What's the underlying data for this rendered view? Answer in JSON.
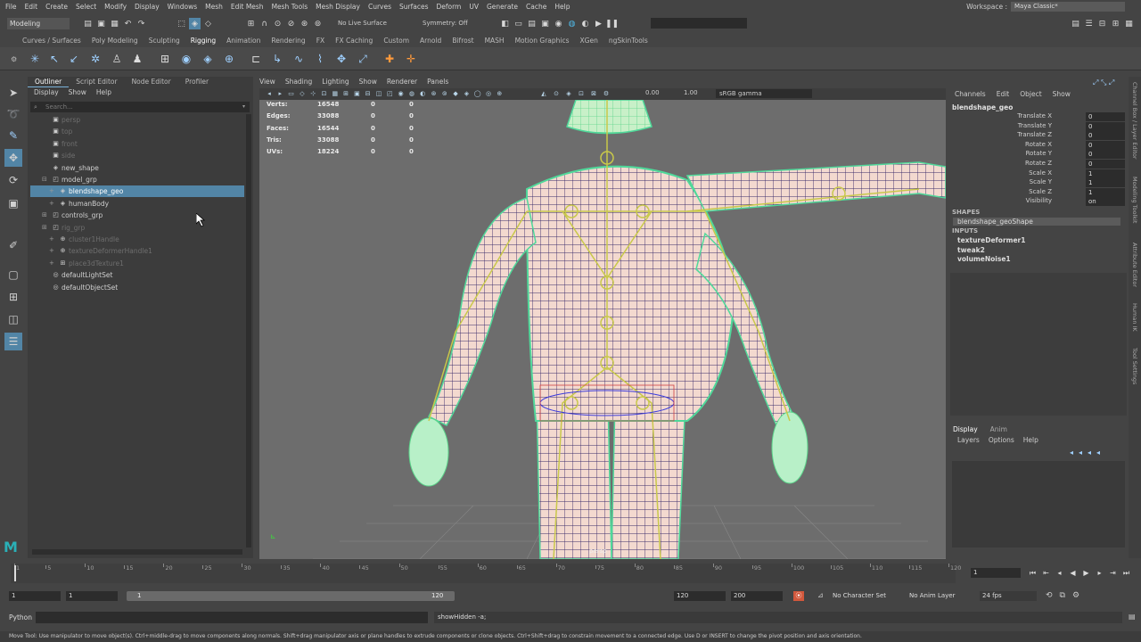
{
  "menubar": {
    "items": [
      "File",
      "Edit",
      "Create",
      "Select",
      "Modify",
      "Display",
      "Windows",
      "Mesh",
      "Edit Mesh",
      "Mesh Tools",
      "Mesh Display",
      "Curves",
      "Surfaces",
      "Deform",
      "UV",
      "Generate",
      "Cache",
      "Help"
    ],
    "workspace_label": "Workspace :",
    "workspace_value": "Maya Classic*"
  },
  "statusline": {
    "mode": "Modeling",
    "live_surface": "No Live Surface",
    "symmetry": "Symmetry: Off"
  },
  "shelf": {
    "tabs": [
      "Curves / Surfaces",
      "Poly Modeling",
      "Sculpting",
      "Rigging",
      "Animation",
      "Rendering",
      "FX",
      "FX Caching",
      "Custom",
      "Arnold",
      "Bifrost",
      "MASH",
      "Motion Graphics",
      "XGen",
      "ngSkinTools"
    ],
    "active_tab": "Rigging"
  },
  "outliner": {
    "tabs": [
      "Outliner",
      "Script Editor",
      "Node Editor",
      "Profiler"
    ],
    "menu": [
      "Display",
      "Show",
      "Help"
    ],
    "search_placeholder": "Search...",
    "rows": [
      {
        "label": "persp",
        "dim": true
      },
      {
        "label": "top",
        "dim": true
      },
      {
        "label": "front",
        "dim": true
      },
      {
        "label": "side",
        "dim": true
      },
      {
        "label": "new_shape",
        "dim": false
      },
      {
        "label": "model_grp",
        "dim": false
      },
      {
        "label": "blendshape_geo",
        "dim": false,
        "selected": true
      },
      {
        "label": "humanBody",
        "dim": false
      },
      {
        "label": "controls_grp",
        "dim": false
      },
      {
        "label": "rig_grp",
        "dim": true
      },
      {
        "label": "cluster1Handle",
        "dim": true
      },
      {
        "label": "textureDeformerHandle1",
        "dim": true
      },
      {
        "label": "place3dTexture1",
        "dim": true
      },
      {
        "label": "defaultLightSet",
        "dim": false
      },
      {
        "label": "defaultObjectSet",
        "dim": false
      }
    ]
  },
  "viewport": {
    "menu": [
      "View",
      "Shading",
      "Lighting",
      "Show",
      "Renderer",
      "Panels"
    ],
    "exposure": "0.00",
    "gamma": "1.00",
    "color_space": "sRGB gamma",
    "camera": "persp",
    "hud": [
      {
        "label": "Verts:",
        "v1": "16548",
        "v2": "0",
        "v3": "0"
      },
      {
        "label": "Edges:",
        "v1": "33088",
        "v2": "0",
        "v3": "0"
      },
      {
        "label": "Faces:",
        "v1": "16544",
        "v2": "0",
        "v3": "0"
      },
      {
        "label": "Tris:",
        "v1": "33088",
        "v2": "0",
        "v3": "0"
      },
      {
        "label": "UVs:",
        "v1": "18224",
        "v2": "0",
        "v3": "0"
      }
    ]
  },
  "channelbox": {
    "menu": [
      "Channels",
      "Edit",
      "Object",
      "Show"
    ],
    "object": "blendshape_geo",
    "attributes": [
      {
        "name": "Translate X",
        "value": "0"
      },
      {
        "name": "Translate Y",
        "value": "0"
      },
      {
        "name": "Translate Z",
        "value": "0"
      },
      {
        "name": "Rotate X",
        "value": "0"
      },
      {
        "name": "Rotate Y",
        "value": "0"
      },
      {
        "name": "Rotate Z",
        "value": "0"
      },
      {
        "name": "Scale X",
        "value": "1"
      },
      {
        "name": "Scale Y",
        "value": "1"
      },
      {
        "name": "Scale Z",
        "value": "1"
      },
      {
        "name": "Visibility",
        "value": "on"
      }
    ],
    "shapes_header": "SHAPES",
    "shape": "blendshape_geoShape",
    "inputs_header": "INPUTS",
    "inputs": [
      "textureDeformer1",
      "tweak2",
      "volumeNoise1"
    ],
    "side_tabs": [
      "Channel Box / Layer Editor",
      "Modeling Toolkit",
      "Attribute Editor",
      "Human IK",
      "Tool Settings"
    ]
  },
  "layer_editor": {
    "tabs": [
      "Display",
      "Anim"
    ],
    "menu": [
      "Layers",
      "Options",
      "Help"
    ]
  },
  "timeslider": {
    "ticks": [
      "1",
      "5",
      "10",
      "15",
      "20",
      "25",
      "30",
      "35",
      "40",
      "45",
      "50",
      "55",
      "60",
      "65",
      "70",
      "75",
      "80",
      "85",
      "90",
      "95",
      "100",
      "105",
      "110",
      "115",
      "120"
    ],
    "current_frame": "1",
    "current_frame_fraction": 0.0
  },
  "rangeslider": {
    "start": "1",
    "playback_start": "1",
    "bar_start": "1",
    "bar_end": "120",
    "playback_end": "120",
    "end": "200",
    "character_set": "No Character Set",
    "anim_layer": "No Anim Layer",
    "fps": "24 fps"
  },
  "cmdline": {
    "language": "Python",
    "result": "showHidden -a;"
  },
  "helpline": "Move Tool: Use manipulator to move object(s). Ctrl+middle-drag to move components along normals. Shift+drag manipulator axis or plane handles to extrude components or clone objects. Ctrl+Shift+drag to constrain movement to a connected edge. Use D or INSERT to change the pivot position and axis orientation."
}
